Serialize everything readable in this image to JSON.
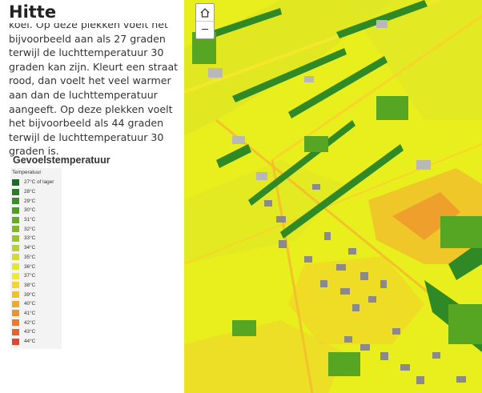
{
  "panel": {
    "title": "Hitte",
    "text": "koel. Op deze plekken voelt het bijvoorbeeld aan als 27 graden terwijl de luchttemperatuur 30 graden kan zijn. Kleurt een straat rood, dan voelt het veel warmer aan dan de luchttemperatuur aangeeft. Op deze plekken voelt het bijvoorbeeld als 44 graden terwijl de luchttemperatuur 30 graden is."
  },
  "legend": {
    "title": "Gevoelstemperatuur",
    "subtitle": "Temperatuur",
    "items": [
      {
        "label": "27°C of lager",
        "color": "#1a6b23"
      },
      {
        "label": "28°C",
        "color": "#2a7e25"
      },
      {
        "label": "29°C",
        "color": "#3a8e24"
      },
      {
        "label": "30°C",
        "color": "#4f9d22"
      },
      {
        "label": "31°C",
        "color": "#66ab22"
      },
      {
        "label": "32°C",
        "color": "#80b924"
      },
      {
        "label": "33°C",
        "color": "#9ac52a"
      },
      {
        "label": "34°C",
        "color": "#b7d12e"
      },
      {
        "label": "35°C",
        "color": "#d3dc30"
      },
      {
        "label": "36°C",
        "color": "#e6e52d"
      },
      {
        "label": "37°C",
        "color": "#f2e92a"
      },
      {
        "label": "38°C",
        "color": "#f6d62a"
      },
      {
        "label": "39°C",
        "color": "#f3c12b"
      },
      {
        "label": "40°C",
        "color": "#f1a92b"
      },
      {
        "label": "41°C",
        "color": "#ef922c"
      },
      {
        "label": "42°C",
        "color": "#ec7a2d"
      },
      {
        "label": "43°C",
        "color": "#e8612d"
      },
      {
        "label": "44°C",
        "color": "#e3452c"
      }
    ]
  },
  "map": {
    "zoom_home_icon": "home-icon",
    "zoom_out_label": "−",
    "colors": {
      "base": "#e9ef1d",
      "cool": "#b7d12e",
      "green_dark": "#2f8a25",
      "green_mid": "#56a623",
      "warm": "#f3c12b",
      "hot": "#ef922c",
      "building": "#8a8a8a"
    }
  }
}
